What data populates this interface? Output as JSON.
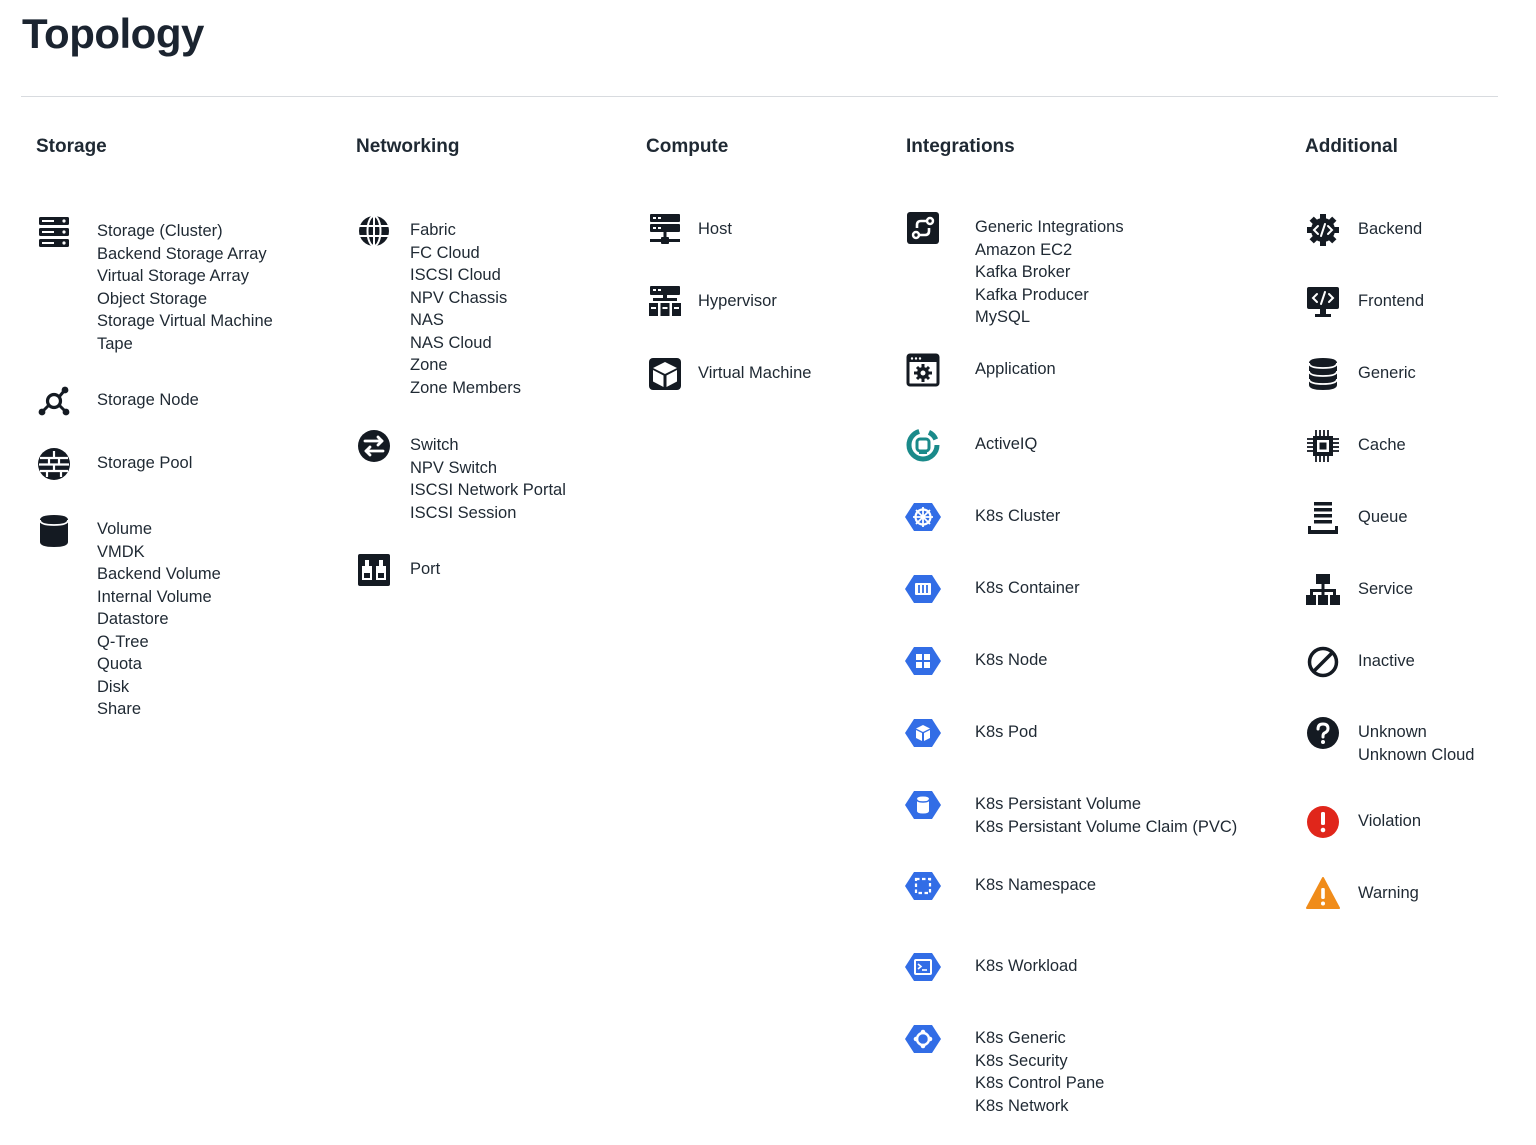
{
  "page_title": "Topology",
  "colors": {
    "k8s_blue": "#326de6",
    "activeiq_teal": "#1a8a8a",
    "violation_red": "#e0261b",
    "warning_orange": "#f08c1a",
    "icon_dark": "#141a22"
  },
  "sections": {
    "storage": {
      "header": "Storage",
      "entries": [
        {
          "icon": "server-stack-icon",
          "lines": [
            "Storage (Cluster)",
            "Backend Storage Array",
            "Virtual Storage Array",
            "Object Storage",
            "Storage Virtual Machine",
            "Tape"
          ]
        },
        {
          "icon": "storage-node-icon",
          "lines": [
            "Storage Node"
          ]
        },
        {
          "icon": "storage-pool-icon",
          "lines": [
            "Storage Pool"
          ]
        },
        {
          "icon": "volume-cylinder-icon",
          "lines": [
            "Volume",
            "VMDK",
            "Backend Volume",
            "Internal Volume",
            "Datastore",
            "Q-Tree",
            "Quota",
            "Disk",
            "Share"
          ]
        }
      ]
    },
    "networking": {
      "header": "Networking",
      "entries": [
        {
          "icon": "globe-grid-icon",
          "lines": [
            "Fabric",
            "FC Cloud",
            "ISCSI Cloud",
            "NPV Chassis",
            "NAS",
            "NAS Cloud",
            "Zone",
            "Zone Members"
          ]
        },
        {
          "icon": "switch-arrows-icon",
          "lines": [
            "Switch",
            "NPV Switch",
            "ISCSI Network Portal",
            "ISCSI Session"
          ]
        },
        {
          "icon": "port-icon",
          "lines": [
            "Port"
          ]
        }
      ]
    },
    "compute": {
      "header": "Compute",
      "entries": [
        {
          "icon": "host-server-icon",
          "lines": [
            "Host"
          ]
        },
        {
          "icon": "hypervisor-icon",
          "lines": [
            "Hypervisor"
          ]
        },
        {
          "icon": "virtual-machine-cube-icon",
          "lines": [
            "Virtual Machine"
          ]
        }
      ]
    },
    "integrations": {
      "header": "Integrations",
      "entries": [
        {
          "icon": "integration-route-icon",
          "lines": [
            "Generic Integrations",
            "Amazon EC2",
            "Kafka Broker",
            "Kafka Producer",
            "MySQL"
          ]
        },
        {
          "icon": "application-window-icon",
          "lines": [
            "Application"
          ]
        },
        {
          "icon": "activeiq-icon",
          "lines": [
            "ActiveIQ"
          ]
        },
        {
          "icon": "k8s-cluster-icon",
          "lines": [
            "K8s Cluster"
          ]
        },
        {
          "icon": "k8s-container-icon",
          "lines": [
            "K8s Container"
          ]
        },
        {
          "icon": "k8s-node-icon",
          "lines": [
            "K8s Node"
          ]
        },
        {
          "icon": "k8s-pod-icon",
          "lines": [
            "K8s Pod"
          ]
        },
        {
          "icon": "k8s-persistent-volume-icon",
          "lines": [
            "K8s Persistant Volume",
            "K8s Persistant Volume Claim (PVC)"
          ]
        },
        {
          "icon": "k8s-namespace-icon",
          "lines": [
            "K8s Namespace"
          ]
        },
        {
          "icon": "k8s-workload-icon",
          "lines": [
            "K8s Workload"
          ]
        },
        {
          "icon": "k8s-generic-icon",
          "lines": [
            "K8s Generic",
            "K8s Security",
            "K8s Control Pane",
            "K8s Network"
          ]
        }
      ]
    },
    "additional": {
      "header": "Additional",
      "entries": [
        {
          "icon": "backend-gear-code-icon",
          "lines": [
            "Backend"
          ]
        },
        {
          "icon": "frontend-monitor-code-icon",
          "lines": [
            "Frontend"
          ]
        },
        {
          "icon": "database-icon",
          "lines": [
            "Generic"
          ]
        },
        {
          "icon": "cache-chip-icon",
          "lines": [
            "Cache"
          ]
        },
        {
          "icon": "queue-icon",
          "lines": [
            "Queue"
          ]
        },
        {
          "icon": "service-hierarchy-icon",
          "lines": [
            "Service"
          ]
        },
        {
          "icon": "inactive-ban-icon",
          "lines": [
            "Inactive"
          ]
        },
        {
          "icon": "unknown-question-icon",
          "lines": [
            "Unknown",
            "Unknown Cloud"
          ]
        },
        {
          "icon": "violation-exclamation-icon",
          "lines": [
            "Violation"
          ]
        },
        {
          "icon": "warning-triangle-icon",
          "lines": [
            "Warning"
          ]
        }
      ]
    }
  }
}
